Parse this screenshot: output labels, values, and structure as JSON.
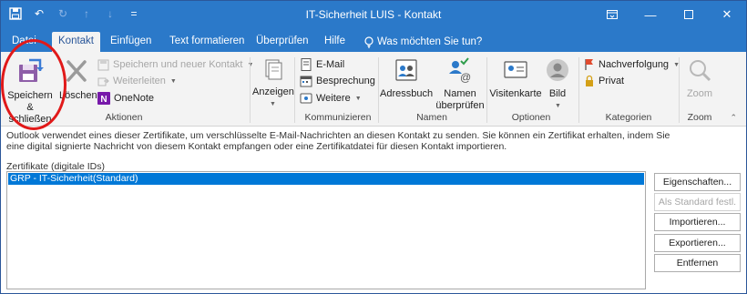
{
  "window": {
    "title": "IT-Sicherheit LUIS  -  Kontakt",
    "qat_more": "="
  },
  "tabs": [
    {
      "label": "Datei"
    },
    {
      "label": "Kontakt"
    },
    {
      "label": "Einfügen"
    },
    {
      "label": "Text formatieren"
    },
    {
      "label": "Überprüfen"
    },
    {
      "label": "Hilfe"
    },
    {
      "label": "Was möchten Sie tun?"
    }
  ],
  "ribbon": {
    "aktionen": {
      "label": "Aktionen",
      "save_close_line1": "Speichern",
      "save_close_line2": "& schließen",
      "delete": "Löschen",
      "save_new": "Speichern und neuer Kontakt",
      "forward": "Weiterleiten",
      "onenote": "OneNote"
    },
    "anzeigen": {
      "label": "Anzeigen"
    },
    "kommunizieren": {
      "label": "Kommunizieren",
      "email": "E-Mail",
      "meeting": "Besprechung",
      "more": "Weitere"
    },
    "namen": {
      "label": "Namen",
      "addressbook": "Adressbuch",
      "check_names_line1": "Namen",
      "check_names_line2": "überprüfen"
    },
    "optionen": {
      "label": "Optionen",
      "business_card": "Visitenkarte",
      "picture": "Bild"
    },
    "kategorien": {
      "label": "Kategorien",
      "followup": "Nachverfolgung",
      "private": "Privat"
    },
    "zoom": {
      "label": "Zoom",
      "zoom": "Zoom"
    }
  },
  "content": {
    "info_line1": "Outlook verwendet eines dieser Zertifikate, um verschlüsselte E-Mail-Nachrichten an diesen Kontakt zu senden. Sie können ein Zertifikat erhalten, indem Sie",
    "info_line2": "eine digital signierte Nachricht von diesem Kontakt empfangen oder eine Zertifikatdatei für diesen Kontakt importieren.",
    "cert_label": "Zertifikate (digitale IDs)",
    "certificates": [
      "GRP - IT-Sicherheit(Standard)"
    ]
  },
  "actions": {
    "properties": "Eigenschaften...",
    "set_default": "Als Standard festl.",
    "import": "Importieren...",
    "export": "Exportieren...",
    "remove": "Entfernen"
  },
  "colors": {
    "accent": "#2b79c9",
    "selection": "#0078d7",
    "annotation_circle": "#e11919"
  }
}
